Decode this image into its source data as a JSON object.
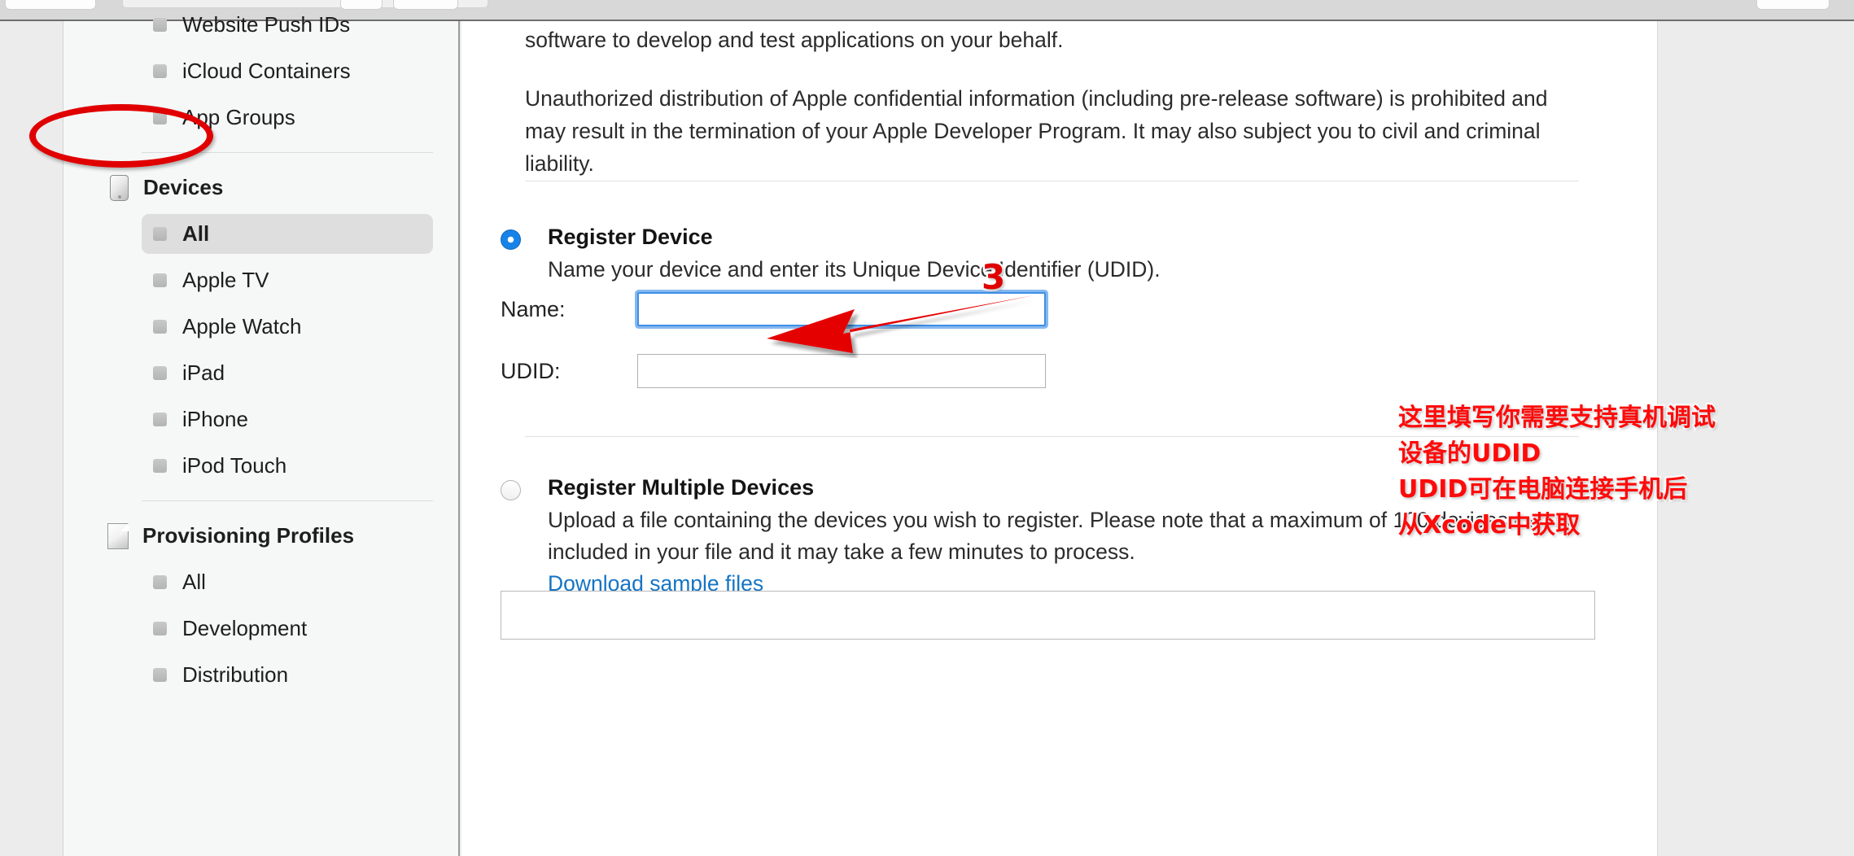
{
  "window": {
    "chrome_visible": true
  },
  "sidebar": {
    "items": [
      {
        "label": "Website Push IDs",
        "type": "child",
        "selected": false,
        "icon": "bullet-icon"
      },
      {
        "label": "iCloud Containers",
        "type": "child",
        "selected": false,
        "icon": "bullet-icon"
      },
      {
        "label": "App Groups",
        "type": "child",
        "selected": false,
        "icon": "bullet-icon"
      },
      {
        "label": "Devices",
        "type": "group",
        "selected": false,
        "icon": "device-icon"
      },
      {
        "label": "All",
        "type": "child",
        "selected": true,
        "icon": "bullet-icon"
      },
      {
        "label": "Apple TV",
        "type": "child",
        "selected": false,
        "icon": "bullet-icon"
      },
      {
        "label": "Apple Watch",
        "type": "child",
        "selected": false,
        "icon": "bullet-icon"
      },
      {
        "label": "iPad",
        "type": "child",
        "selected": false,
        "icon": "bullet-icon"
      },
      {
        "label": "iPhone",
        "type": "child",
        "selected": false,
        "icon": "bullet-icon"
      },
      {
        "label": "iPod Touch",
        "type": "child",
        "selected": false,
        "icon": "bullet-icon"
      },
      {
        "label": "Provisioning Profiles",
        "type": "group",
        "selected": false,
        "icon": "document-icon"
      },
      {
        "label": "All",
        "type": "child",
        "selected": false,
        "icon": "bullet-icon"
      },
      {
        "label": "Development",
        "type": "child",
        "selected": false,
        "icon": "bullet-icon"
      },
      {
        "label": "Distribution",
        "type": "child",
        "selected": false,
        "icon": "bullet-icon"
      }
    ]
  },
  "main": {
    "paragraph_clipped": "software to develop and test applications on your behalf.",
    "paragraph_unauthorized": "Unauthorized distribution of Apple confidential information (including pre-release software) is prohibited and may result in the termination of your Apple Developer Program. It may also subject you to civil and criminal liability.",
    "register_device": {
      "title": "Register Device",
      "description": "Name your device and enter its Unique Device Identifier (UDID).",
      "selected": true,
      "name_label": "Name:",
      "name_value": "",
      "udid_label": "UDID:",
      "udid_value": ""
    },
    "register_multiple": {
      "title": "Register Multiple Devices",
      "description": "Upload a file containing the devices you wish to register. Please note that a maximum of 100 devices can be included in your file and it may take a few minutes to process.",
      "link_label": "Download sample files",
      "selected": false
    }
  },
  "annotations": {
    "step_badge": "3",
    "chinese_note_line1": "这里填写你需要支持真机调试",
    "chinese_note_line2": "设备的UDID",
    "chinese_note_line3": "UDID可在电脑连接手机后",
    "chinese_note_line4": "从Xcode中获取",
    "ellipse_target": "Devices / All",
    "arrow_target": "Register Device"
  },
  "colors": {
    "annotation_red": "#e00000",
    "note_red": "#ff0a0a",
    "radio_blue": "#1783e8",
    "link_blue": "#1574c4",
    "focus_blue": "#3e8fe8",
    "sidebar_bg": "#f6f8f8",
    "selected_row": "#dedede",
    "page_bg": "#ececec"
  }
}
